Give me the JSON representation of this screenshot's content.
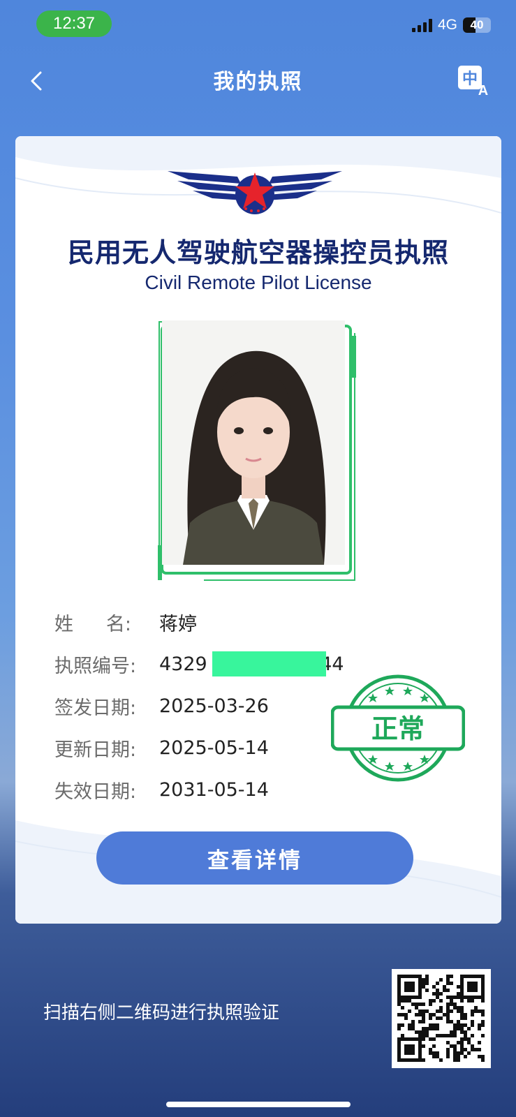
{
  "status_bar": {
    "time": "12:37",
    "network": "4G",
    "battery": "40"
  },
  "nav": {
    "title": "我的执照",
    "translate_glyph": "中",
    "translate_glyph_2": "A"
  },
  "license": {
    "title_cn": "民用无人驾驶航空器操控员执照",
    "title_en": "Civil Remote Pilot License",
    "fields": [
      {
        "label_a": "姓",
        "label_b": "名:",
        "value": "蒋婷"
      },
      {
        "label": "执照编号:",
        "value_prefix": "4329",
        "value_suffix": "68544"
      },
      {
        "label": "签发日期:",
        "value": "2025-03-26"
      },
      {
        "label": "更新日期:",
        "value": "2025-05-14"
      },
      {
        "label": "失效日期:",
        "value": "2031-05-14"
      }
    ],
    "status_stamp": "正常",
    "detail_button": "查看详情"
  },
  "verify": {
    "text": "扫描右侧二维码进行执照验证"
  },
  "colors": {
    "accent": "#4f7bd8",
    "title": "#15286f",
    "stamp": "#1ea85a",
    "time_pill": "#3bb44a"
  }
}
